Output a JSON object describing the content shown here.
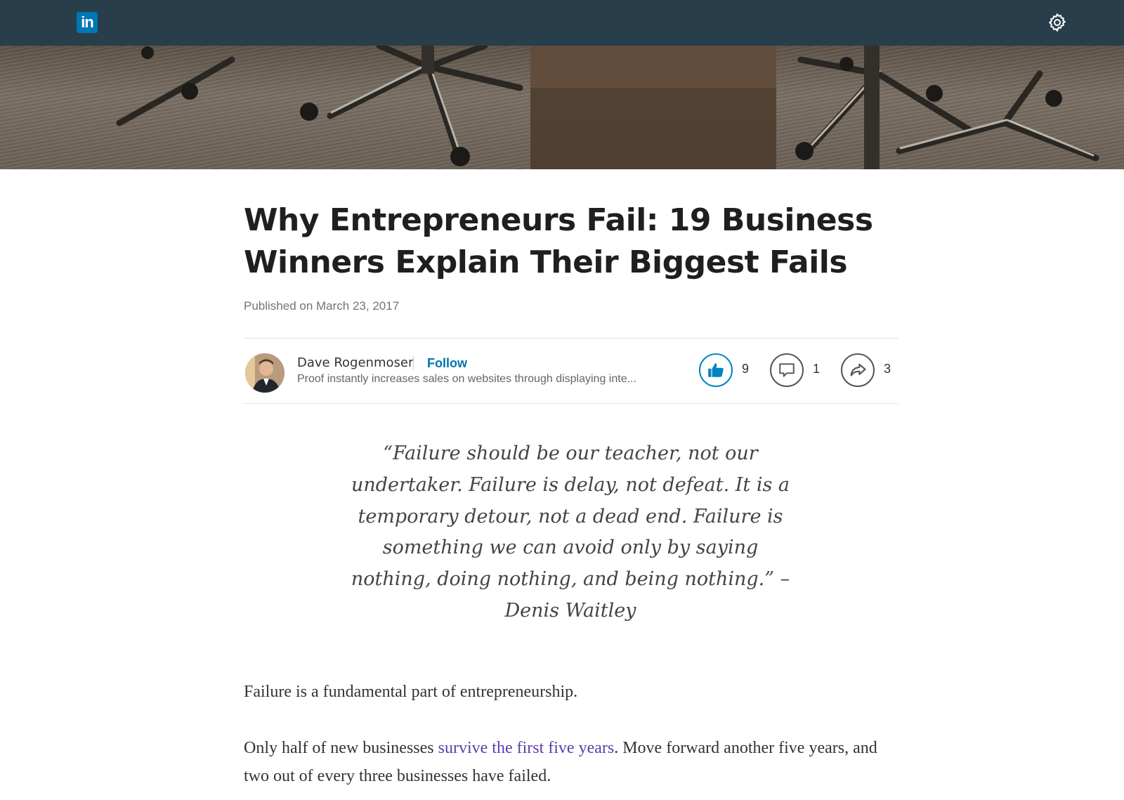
{
  "header": {
    "logo_text": "in",
    "brand_color": "#0077b5",
    "bar_color": "#283e4a",
    "settings_icon": "gear-icon"
  },
  "hero": {
    "image_description_icon": "hero-image"
  },
  "article": {
    "title": "Why Entrepreneurs Fail: 19 Business Winners Explain Their Biggest Fails",
    "published": "Published on March 23, 2017",
    "author": {
      "name": "Dave Rogenmoser",
      "follow_label": "Follow",
      "headline": "Proof instantly increases sales on websites through displaying inte..."
    },
    "actions": {
      "like_count": "9",
      "comment_count": "1",
      "share_count": "3",
      "like_color": "#0084bf"
    },
    "quote": "“Failure should be our teacher, not our undertaker. Failure is delay, not defeat. It is a temporary detour, not a dead end. Failure is something we can avoid only by saying nothing, doing nothing, and being nothing.” – Denis Waitley",
    "paragraph1": "Failure is a fundamental part of entrepreneurship.",
    "paragraph2": {
      "before": "Only half of new businesses ",
      "link": "survive the first five years",
      "after": ". Move forward another five years, and two out of every three businesses have failed.",
      "link_color": "#5c3dad"
    }
  }
}
